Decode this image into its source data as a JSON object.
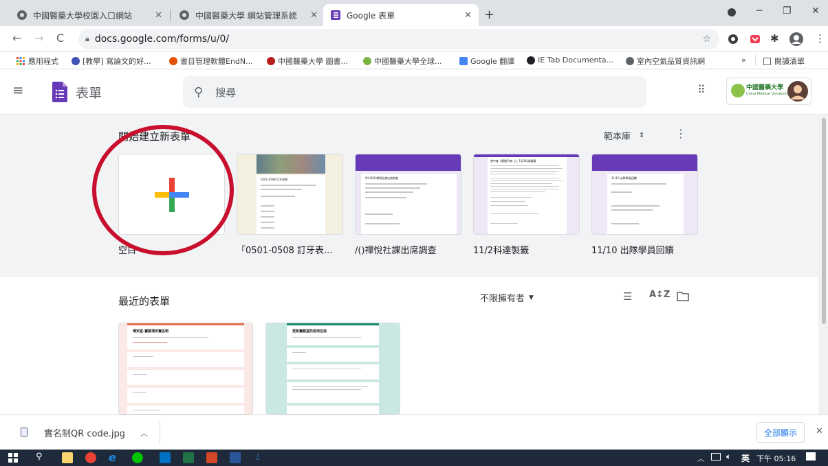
{
  "browser": {
    "tabs": [
      {
        "title": "中國醫藥大學校園入口網站"
      },
      {
        "title": "中國醫藥大學 網站管理系統"
      },
      {
        "title": "Google 表單"
      }
    ],
    "url": "docs.google.com/forms/u/0/",
    "bookmarks": [
      {
        "label": "應用程式"
      },
      {
        "label": "[教學] 寫論文的好..."
      },
      {
        "label": "書目管理軟體EndN..."
      },
      {
        "label": "中國醫藥大學 圖書..."
      },
      {
        "label": "中國醫藥大學全球..."
      },
      {
        "label": "Google 翻譯"
      },
      {
        "label": "IE Tab Documenta..."
      },
      {
        "label": "室內空氣品質資訊網"
      }
    ],
    "reading_list": "閱讀清單",
    "overflow": "»"
  },
  "app": {
    "name": "表單",
    "search_placeholder": "搜尋",
    "org_logo_text": "中國醫藥大學",
    "org_logo_sub": "China Medical University"
  },
  "gallery": {
    "heading": "開始建立新表單",
    "template_gallery_label": "範本庫",
    "items": [
      {
        "title": "空白"
      },
      {
        "title": "「0501-0508 訂牙表...",
        "thumb_title": "0501-0508 訂牙表單"
      },
      {
        "title": "/()禪悅社課出席調查",
        "thumb_title": "9/24(四)禪悅社課出席調查"
      },
      {
        "title": "11/2科達製籤",
        "thumb_title": "普中會《圓融手扉-上》11/2科達製籤"
      },
      {
        "title": "11/10 出隊學員回饋",
        "thumb_title": "11/10 出隊學員回饋"
      }
    ]
  },
  "recent": {
    "heading": "最近的表單",
    "owner_filter": "不限擁有者",
    "forms": [
      {
        "thumb_title": "環安室-實驗場所實名制"
      },
      {
        "thumb_title": "更新實驗室防疫用名冊"
      }
    ]
  },
  "download": {
    "filename": "實名制QR code.jpg",
    "show_all": "全部顯示"
  },
  "taskbar": {
    "ime": "英",
    "time": "下午 05:16"
  },
  "colors": {
    "forms_purple": "#673ab7",
    "google_blue": "#4285f4",
    "google_red": "#ea4335",
    "google_yellow": "#fbbc04",
    "google_green": "#34a853",
    "annotation_red": "#c8102e"
  }
}
